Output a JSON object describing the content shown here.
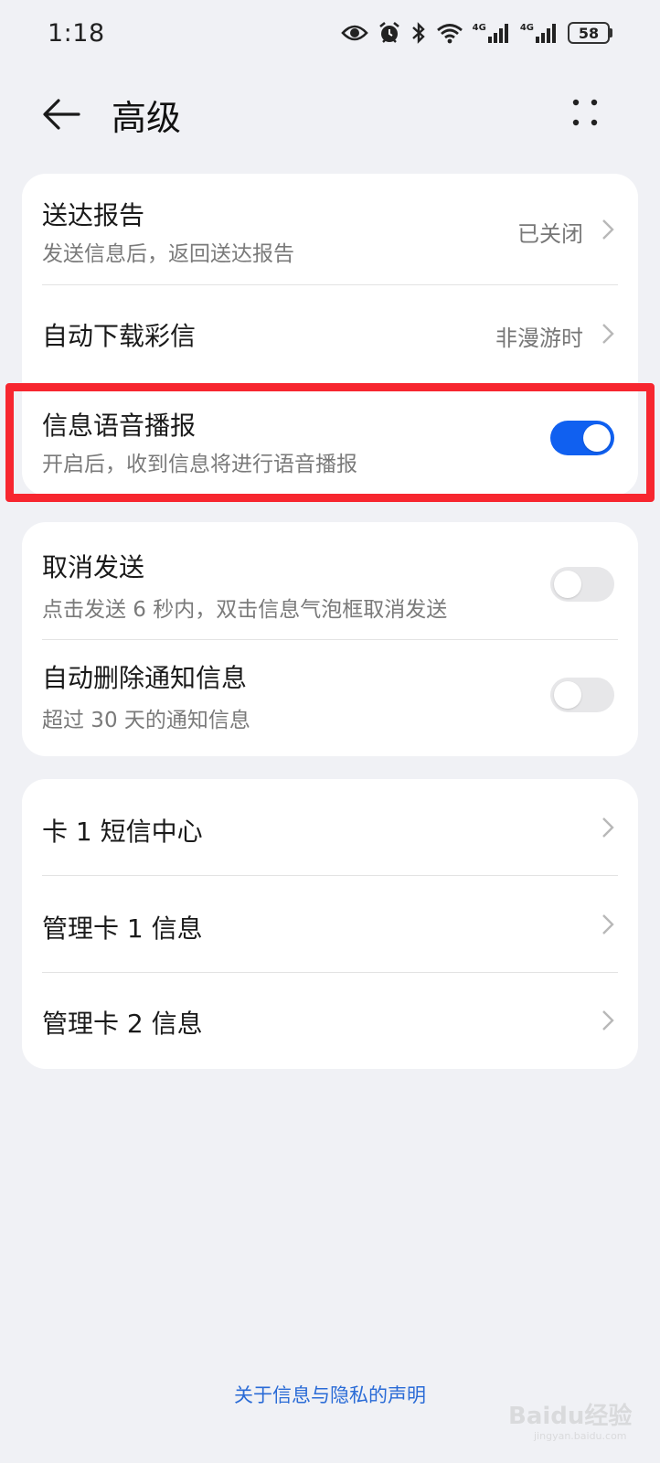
{
  "status_bar": {
    "time": "1:18",
    "network1": "4G",
    "network2": "4G",
    "battery": "58",
    "icons": [
      "eye-icon",
      "alarm-icon",
      "bluetooth-icon",
      "wifi-icon",
      "signal-icon",
      "signal-icon",
      "battery-icon"
    ]
  },
  "header": {
    "title": "高级"
  },
  "card1": {
    "delivery_report": {
      "title": "送达报告",
      "subtitle": "发送信息后，返回送达报告",
      "value": "已关闭"
    },
    "auto_download_mms": {
      "title": "自动下载彩信",
      "value": "非漫游时"
    },
    "voice_broadcast": {
      "title": "信息语音播报",
      "subtitle": "开启后，收到信息将进行语音播报",
      "enabled": true
    }
  },
  "card2": {
    "cancel_send": {
      "title": "取消发送",
      "subtitle": "点击发送 6 秒内，双击信息气泡框取消发送",
      "enabled": false
    },
    "auto_delete": {
      "title": "自动删除通知信息",
      "subtitle": "超过 30 天的通知信息",
      "enabled": false
    }
  },
  "card3": {
    "items": [
      {
        "title": "卡 1 短信中心"
      },
      {
        "title": "管理卡 1 信息"
      },
      {
        "title": "管理卡 2 信息"
      }
    ]
  },
  "footer": {
    "privacy_link": "关于信息与隐私的声明"
  },
  "watermark": {
    "text": "Baidu经验",
    "sub": "jingyan.baidu.com"
  },
  "colors": {
    "accent": "#1060f0",
    "highlight": "#f7262f",
    "link": "#2a6bd6",
    "background": "#f0f1f5"
  }
}
